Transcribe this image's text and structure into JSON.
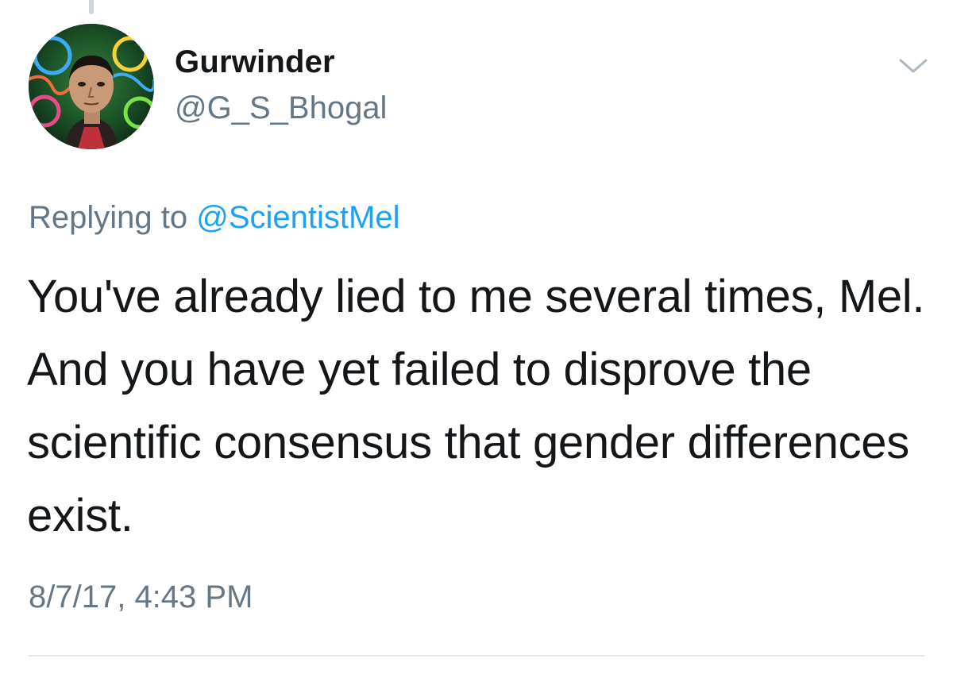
{
  "tweet": {
    "display_name": "Gurwinder",
    "handle": "@G_S_Bhogal",
    "reply_prefix": "Replying to ",
    "reply_to": "@ScientistMel",
    "text": "You've already lied to me several times, Mel. And you have yet failed to disprove the scientific consensus that gender differences exist.",
    "timestamp": "8/7/17, 4:43 PM"
  },
  "icons": {
    "menu": "chevron-down-icon",
    "avatar": "avatar"
  },
  "colors": {
    "text": "#14171a",
    "secondary": "#657786",
    "link": "#1da1f2",
    "divider": "#e1e8ed"
  }
}
